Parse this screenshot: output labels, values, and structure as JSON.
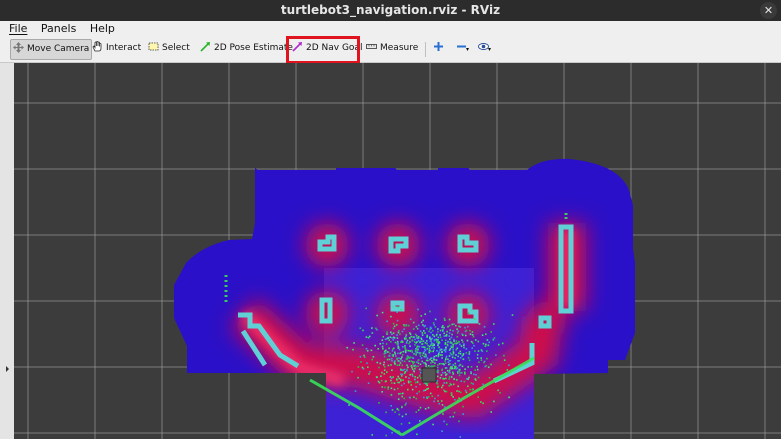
{
  "window": {
    "title": "turtlebot3_navigation.rviz - RViz",
    "close_glyph": "✕"
  },
  "menu": {
    "items": [
      "File",
      "Panels",
      "Help"
    ]
  },
  "toolbar": {
    "move_camera": "Move Camera",
    "interact": "Interact",
    "select": "Select",
    "pose_estimate": "2D Pose Estimate",
    "nav_goal": "2D Nav Goal",
    "measure": "Measure"
  },
  "colors": {
    "accent": "#e0141e",
    "background": "#3c3c3c",
    "grid": "#a0a0a0",
    "costmap_low": "#2a10c8",
    "costmap_high": "#d0104a",
    "obstacle": "#5fd1d6",
    "laser": "#39e05a"
  }
}
